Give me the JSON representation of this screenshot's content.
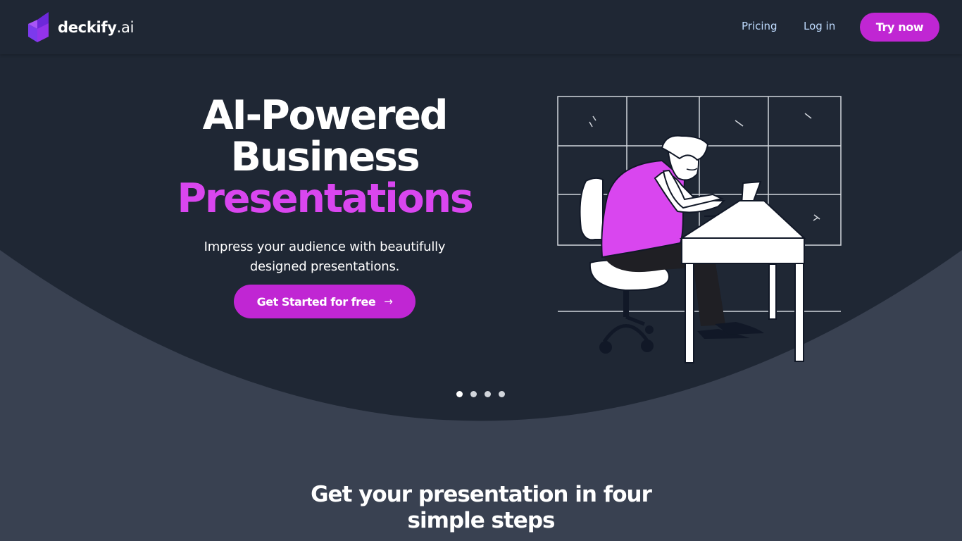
{
  "brand": {
    "name": "deckify",
    "suffix": ".ai",
    "accent_color": "#c026d3",
    "logo_color": "#7c3aed"
  },
  "nav": {
    "pricing_label": "Pricing",
    "login_label": "Log in",
    "cta_label": "Try now"
  },
  "hero": {
    "title_line1": "AI-Powered",
    "title_line2": "Business",
    "title_line3": "Presentations",
    "subtitle": "Impress your audience with beautifully designed presentations.",
    "cta_label": "Get Started for free",
    "cta_icon": "arrow-right-icon",
    "illustration": "person-typing-on-laptop-at-desk",
    "carousel_slides": 4,
    "carousel_active_index": 0
  },
  "steps": {
    "title": "Get your presentation in four simple steps"
  },
  "colors": {
    "header_bg": "#1f2734",
    "hero_bg": "#1f2734",
    "page_bg": "#394151",
    "highlight": "#d946ef",
    "nav_link": "#bfdbfe"
  }
}
